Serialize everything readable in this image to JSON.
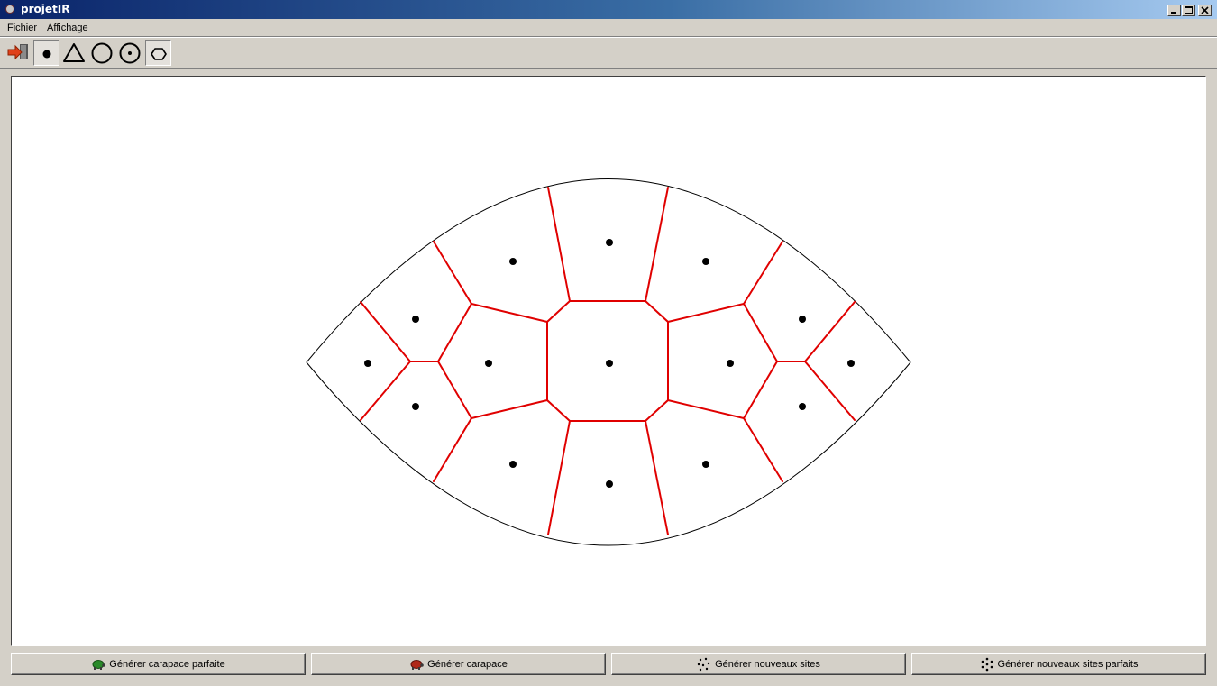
{
  "window": {
    "title": "projetIR"
  },
  "menu": {
    "items": [
      "Fichier",
      "Affichage"
    ]
  },
  "toolbar": {
    "tools": [
      "exit-icon",
      "point-icon",
      "triangle-icon",
      "circle-icon",
      "circle-center-icon",
      "hexagon-icon"
    ],
    "pressed": [
      "point-icon",
      "hexagon-icon"
    ]
  },
  "buttons": {
    "perfect_shell": "Générer carapace parfaite",
    "shell": "Générer carapace",
    "new_sites": "Générer nouveaux sites",
    "new_perfect_sites": "Générer nouveaux sites parfaits"
  },
  "colors": {
    "edge": "#e00000",
    "outline": "#000000",
    "site": "#000000"
  }
}
